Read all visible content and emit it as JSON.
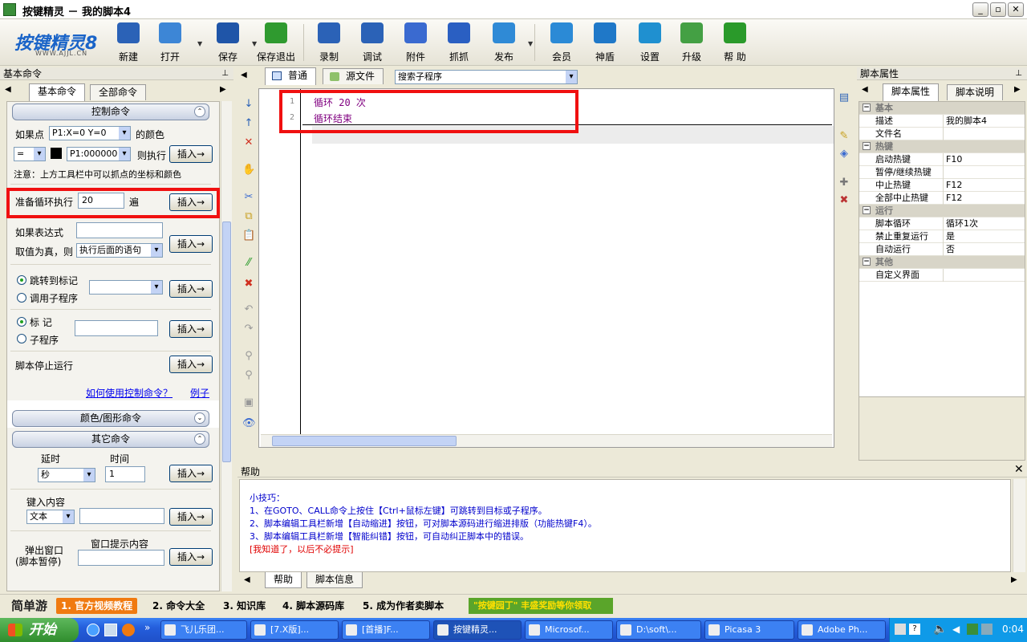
{
  "window": {
    "title": "按键精灵 － 我的脚本4"
  },
  "logo": {
    "brand": "按键精灵8",
    "url": "WWW.AJJL.CN"
  },
  "toolbar": {
    "buttons": [
      "新建",
      "打开",
      "保存",
      "保存退出",
      "录制",
      "调试",
      "附件",
      "抓抓",
      "发布",
      "会员",
      "神盾",
      "设置",
      "升级",
      "帮 助"
    ]
  },
  "left_panel": {
    "title": "基本命令",
    "tabs": [
      "基本命令",
      "全部命令"
    ],
    "control_group": "控制命令",
    "if_point_label": "如果点",
    "if_point_select": "P1:X=0 Y=0",
    "color_suffix": "的颜色",
    "eq_select": "=",
    "color_select": "P1:000000",
    "then_exec": "则执行",
    "insert": "插入→",
    "note": "注意：上方工具栏中可以抓点的坐标和颜色",
    "loop_label": "准备循环执行",
    "loop_value": "20",
    "loop_unit": "遍",
    "if_expr_label": "如果表达式",
    "if_true_label": "取值为真，则",
    "if_true_select": "执行后面的语句",
    "goto_label": "跳转到标记",
    "call_label": "调用子程序",
    "mark_label": "标 记",
    "sub_label": "子程序",
    "stop_label": "脚本停止运行",
    "howto_link": "如何使用控制命令？",
    "example_link": "例子",
    "color_group": "颜色/图形命令",
    "other_group": "其它命令",
    "delay_label": "延时",
    "time_label": "时间",
    "delay_unit": "秒",
    "delay_value": "1",
    "keyin_label": "键入内容",
    "keyin_select": "文本",
    "popup_label": "弹出窗口",
    "popup_sub": "(脚本暂停)",
    "popup_content": "窗口提示内容"
  },
  "editor": {
    "tabs": [
      "普通",
      "源文件"
    ],
    "sub_select": "搜索子程序",
    "lines": [
      "循环 20 次",
      "循环结束"
    ],
    "line_numbers": [
      "1",
      "2"
    ]
  },
  "right_panel": {
    "title": "脚本属性",
    "tabs": [
      "脚本属性",
      "脚本说明"
    ],
    "rows": [
      {
        "type": "cat",
        "k": "基本"
      },
      {
        "type": "row",
        "k": "描述",
        "v": "我的脚本4"
      },
      {
        "type": "row",
        "k": "文件名",
        "v": ""
      },
      {
        "type": "cat",
        "k": "热键"
      },
      {
        "type": "row",
        "k": "启动热键",
        "v": "F10"
      },
      {
        "type": "row",
        "k": "暂停/继续热键",
        "v": ""
      },
      {
        "type": "row",
        "k": "中止热键",
        "v": "F12"
      },
      {
        "type": "row",
        "k": "全部中止热键",
        "v": "F12"
      },
      {
        "type": "cat",
        "k": "运行"
      },
      {
        "type": "row",
        "k": "脚本循环",
        "v": "循环1次"
      },
      {
        "type": "row",
        "k": "禁止重复运行",
        "v": "是"
      },
      {
        "type": "row",
        "k": "自动运行",
        "v": "否"
      },
      {
        "type": "cat",
        "k": "其他"
      },
      {
        "type": "row",
        "k": "自定义界面",
        "v": ""
      }
    ]
  },
  "help": {
    "title": "帮助",
    "tip_title": "小技巧：",
    "tips": [
      "1、在GOTO、CALL命令上按住【Ctrl+鼠标左键】可跳转到目标或子程序。",
      "2、脚本编辑工具栏新增【自动缩进】按钮，可对脚本源码进行缩进排版（功能热键F4）。",
      "3、脚本编辑工具栏新增【智能纠错】按钮，可自动纠正脚本中的错误。"
    ],
    "dismiss": "[我知道了，以后不必提示]",
    "tabs": [
      "帮助",
      "脚本信息"
    ]
  },
  "bottom_strip": {
    "brand": "简单游",
    "items": [
      "1. 官方视频教程",
      "2. 命令大全",
      "3. 知识库",
      "4. 脚本源码库",
      "5. 成为作者卖脚本"
    ],
    "promo": "\"按键园丁\" 丰盛奖励等你领取"
  },
  "taskbar": {
    "start": "开始",
    "tasks": [
      "飞儿乐团...",
      "[7.X版]...",
      "[首播]F...",
      "按键精灵...",
      "Microsof...",
      "D:\\soft\\...",
      "Picasa 3",
      "Adobe Ph..."
    ],
    "clock": "0:04"
  },
  "colors": {
    "red_box": "#f01010",
    "code": "#800080",
    "help_text": "#0000cc",
    "accent_orange": "#f07a10"
  }
}
